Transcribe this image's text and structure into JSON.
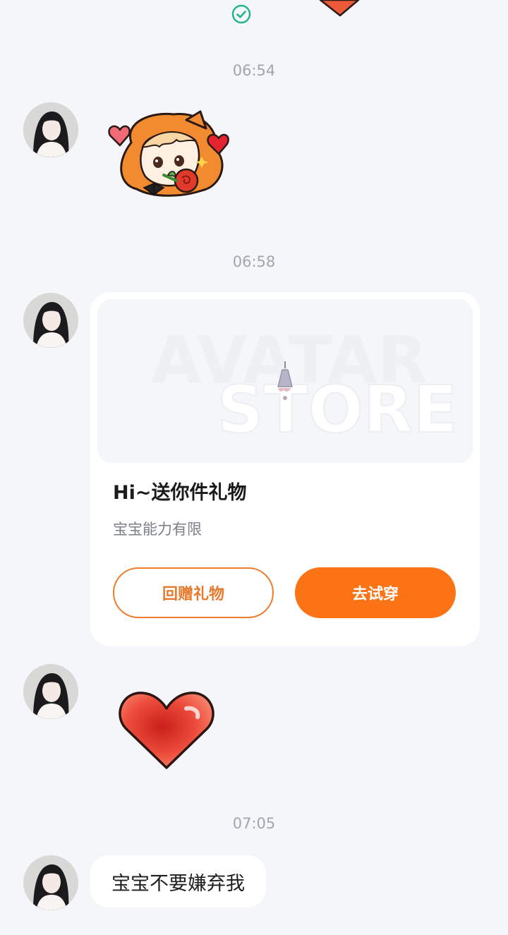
{
  "top": {
    "read_icon": "check-circle-icon",
    "partial_sticker": "heart-sticker"
  },
  "timestamps": [
    "06:54",
    "06:58",
    "07:05"
  ],
  "colors": {
    "background": "#f4f6f9",
    "accent": "#fb7314",
    "accent_outline": "#f07d2e",
    "check": "#21b38a",
    "timestamp": "#a1a6ae"
  },
  "messages": [
    {
      "type": "sticker",
      "sticker": "anime-girl-rose-sticker"
    },
    {
      "type": "gift_card",
      "image_watermark": [
        "AVATAR",
        "STORE"
      ],
      "title": "Hi~送你件礼物",
      "description": "宝宝能力有限",
      "buttons": {
        "return_gift": "回赠礼物",
        "try_on": "去试穿"
      }
    },
    {
      "type": "sticker",
      "sticker": "red-heart-sticker"
    },
    {
      "type": "text",
      "text": "宝宝不要嫌弃我"
    }
  ]
}
